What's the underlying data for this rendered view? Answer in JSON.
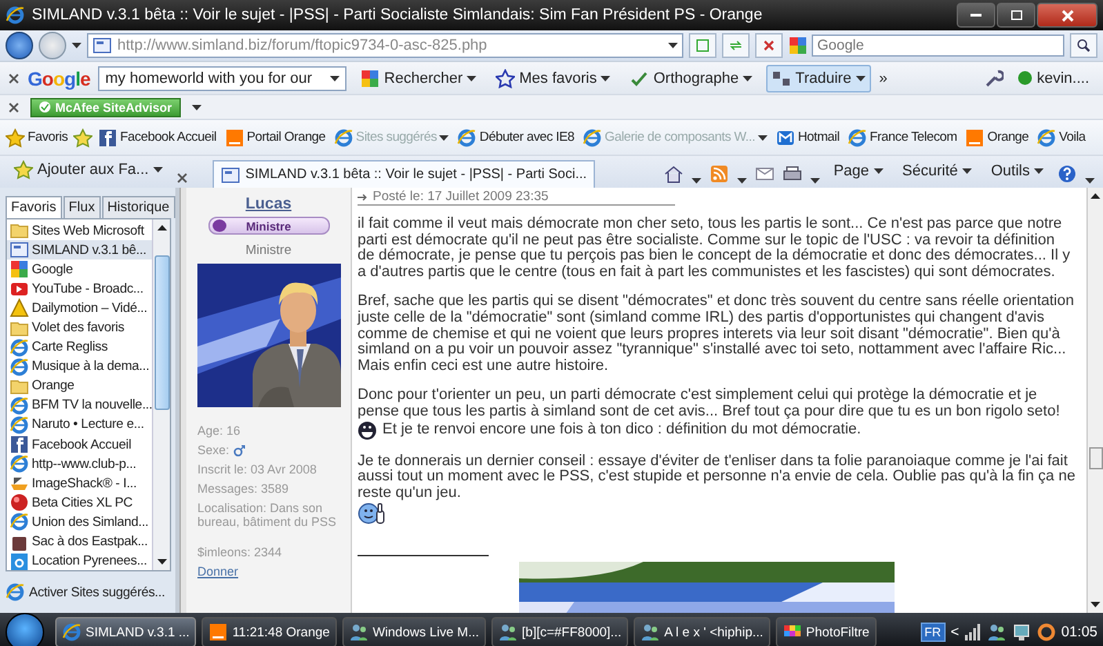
{
  "window": {
    "title": "SIMLAND v.3.1 bêta :: Voir le sujet - |PSS| - Parti Socialiste Simlandais: Sim Fan Président PS - Orange"
  },
  "address_bar": {
    "url": "http://www.simland.biz/forum/ftopic9734-0-asc-825.php",
    "search_placeholder": "Google"
  },
  "google_toolbar": {
    "logo": "Google",
    "query": "my homeworld with you for our",
    "buttons": [
      {
        "label": "Rechercher",
        "kind": "search",
        "selected": false
      },
      {
        "label": "Mes favoris",
        "kind": "star",
        "selected": false
      },
      {
        "label": "Orthographe",
        "kind": "spell",
        "selected": false
      },
      {
        "label": "Traduire",
        "kind": "translate",
        "selected": true
      }
    ],
    "more": "»",
    "account": "kevin...."
  },
  "mcafee_bar": {
    "badge": "McAfee SiteAdvisor"
  },
  "favorites_bar": {
    "label": "Favoris",
    "items": [
      {
        "label": "Facebook  Accueil",
        "kind": "social",
        "disabled": false,
        "menu": false
      },
      {
        "label": "Portail Orange",
        "kind": "orange",
        "disabled": false,
        "menu": false
      },
      {
        "label": "Sites suggérés",
        "kind": "ie",
        "disabled": true,
        "menu": true
      },
      {
        "label": "Débuter avec IE8",
        "kind": "ie",
        "disabled": false,
        "menu": false
      },
      {
        "label": "Galerie de composants W...",
        "kind": "ie",
        "disabled": true,
        "menu": true
      },
      {
        "label": "Hotmail",
        "kind": "mail",
        "disabled": false,
        "menu": false
      },
      {
        "label": "France Telecom",
        "kind": "ie",
        "disabled": false,
        "menu": false
      },
      {
        "label": "Orange",
        "kind": "orange",
        "disabled": false,
        "menu": false
      },
      {
        "label": "Voila",
        "kind": "ie",
        "disabled": false,
        "menu": false
      }
    ]
  },
  "tab_row": {
    "add_favorites": "Ajouter aux Fa...",
    "tab_title": "SIMLAND v.3.1 bêta :: Voir le sujet - |PSS| - Parti Soci...",
    "commands": [
      "Page",
      "Sécurité",
      "Outils"
    ]
  },
  "sidebar": {
    "tabs": [
      {
        "label": "Favoris",
        "selected": true
      },
      {
        "label": "Flux",
        "selected": false
      },
      {
        "label": "Historique",
        "selected": false
      }
    ],
    "items": [
      {
        "label": "Sites Web Microsoft",
        "kind": "folder",
        "selected": false
      },
      {
        "label": "SIMLAND v.3.1 bê...",
        "kind": "site",
        "selected": true
      },
      {
        "label": "Google",
        "kind": "tiles",
        "selected": false
      },
      {
        "label": "YouTube - Broadc...",
        "kind": "video",
        "selected": false
      },
      {
        "label": "Dailymotion – Vidé...",
        "kind": "warning",
        "selected": false
      },
      {
        "label": "Volet des favoris",
        "kind": "folder",
        "selected": false
      },
      {
        "label": "Carte Regliss",
        "kind": "ie",
        "selected": false
      },
      {
        "label": "Musique à la dema...",
        "kind": "ie",
        "selected": false
      },
      {
        "label": "Orange",
        "kind": "folder",
        "selected": false
      },
      {
        "label": "BFM TV la nouvelle...",
        "kind": "ie",
        "selected": false
      },
      {
        "label": "Naruto • Lecture e...",
        "kind": "ie",
        "selected": false
      },
      {
        "label": "Facebook  Accueil",
        "kind": "social",
        "selected": false
      },
      {
        "label": "http--www.club-p...",
        "kind": "ie",
        "selected": false
      },
      {
        "label": "ImageShack® - I...",
        "kind": "boat",
        "selected": false
      },
      {
        "label": "Beta Cities XL PC",
        "kind": "ball",
        "selected": false
      },
      {
        "label": "Union des Simland...",
        "kind": "ie",
        "selected": false
      },
      {
        "label": "Sac à dos Eastpak...",
        "kind": "bag",
        "selected": false
      },
      {
        "label": "Location Pyrenees...",
        "kind": "letter",
        "selected": false
      }
    ],
    "footer": "Activer Sites suggérés..."
  },
  "profile": {
    "name": "Lucas",
    "rank_badge": "Ministre",
    "rank": "Ministre",
    "avatar": {
      "kind": "picture"
    },
    "age": "Age: 16",
    "sex": "Sexe:",
    "joined": "Inscrit le: 03 Avr 2008",
    "messages": "Messages: 3589",
    "location": "Localisation: Dans son bureau, bâtiment du PSS",
    "money": "$imleons: 2344",
    "donate": "Donner"
  },
  "post": {
    "header": "Posté le: 17 Juillet 2009 23:35",
    "paragraphs": [
      [
        {
          "kind": "text",
          "text": "il fait comme il veut mais démocrate mon cher seto, tous les partis le sont... Ce n'est pas parce que notre parti est démocrate qu'il ne peut pas être socialiste. Comme sur le topic de l'USC : va revoir ta définition de démocrate, je pense que tu perçois pas bien le concept de la démocratie et donc des démocrates... Il y a d'autres partis que le centre (tous en fait à part les communistes et les fascistes) qui sont démocrates."
        }
      ],
      [
        {
          "kind": "text",
          "text": "Bref, sache que les partis qui se disent \"démocrates\" et donc très souvent du centre sans réelle orientation juste celle de la \"démocratie\" sont (simland comme IRL) des partis d'opportunistes qui changent d'avis comme de chemise et qui ne voient que leurs propres interets via leur soit disant \"démocratie\". Bien qu'à simland on a pu voir un pouvoir assez \"tyrannique\" s'installé avec toi seto, nottamment avec l'affaire Ric... Mais enfin ceci est une autre histoire."
        }
      ],
      [
        {
          "kind": "text",
          "text": "Donc pour t'orienter un peu, un parti démocrate c'est simplement celui qui protège la démocratie et je pense que tous les partis à simland sont de cet avis... Bref tout ça pour dire que tu es un bon rigolo seto!"
        },
        {
          "kind": "grin"
        },
        {
          "kind": "text",
          "text": "Et je te renvoi encore une fois à ton dico : définition du mot démocratie."
        }
      ],
      [
        {
          "kind": "text",
          "text": "Je te donnerais un dernier conseil : essaye d'éviter de t'enliser dans ta folie paranoiaque comme je l'ai fait aussi tout un moment avec le PSS, c'est stupide et personne n'a envie de cela. Oublie pas qu'à la fin ça ne reste qu'un jeu."
        },
        {
          "kind": "thumbs"
        }
      ]
    ],
    "signature": {
      "kind": "picture"
    }
  },
  "taskbar": {
    "tasks": [
      {
        "label": "SIMLAND v.3.1 ...",
        "kind": "ie",
        "selected": true
      },
      {
        "label": "11:21:48 Orange",
        "kind": "orange",
        "selected": false
      },
      {
        "label": "Windows Live M...",
        "kind": "people",
        "selected": false
      },
      {
        "label": "[b][c=#FF8000]...",
        "kind": "people",
        "selected": false
      },
      {
        "label": "A l e x ' <hiphip...",
        "kind": "people",
        "selected": false
      },
      {
        "label": "PhotoFiltre",
        "selected": false
      }
    ],
    "language": "FR",
    "tray_toggle": "<",
    "clock": "01:05"
  }
}
